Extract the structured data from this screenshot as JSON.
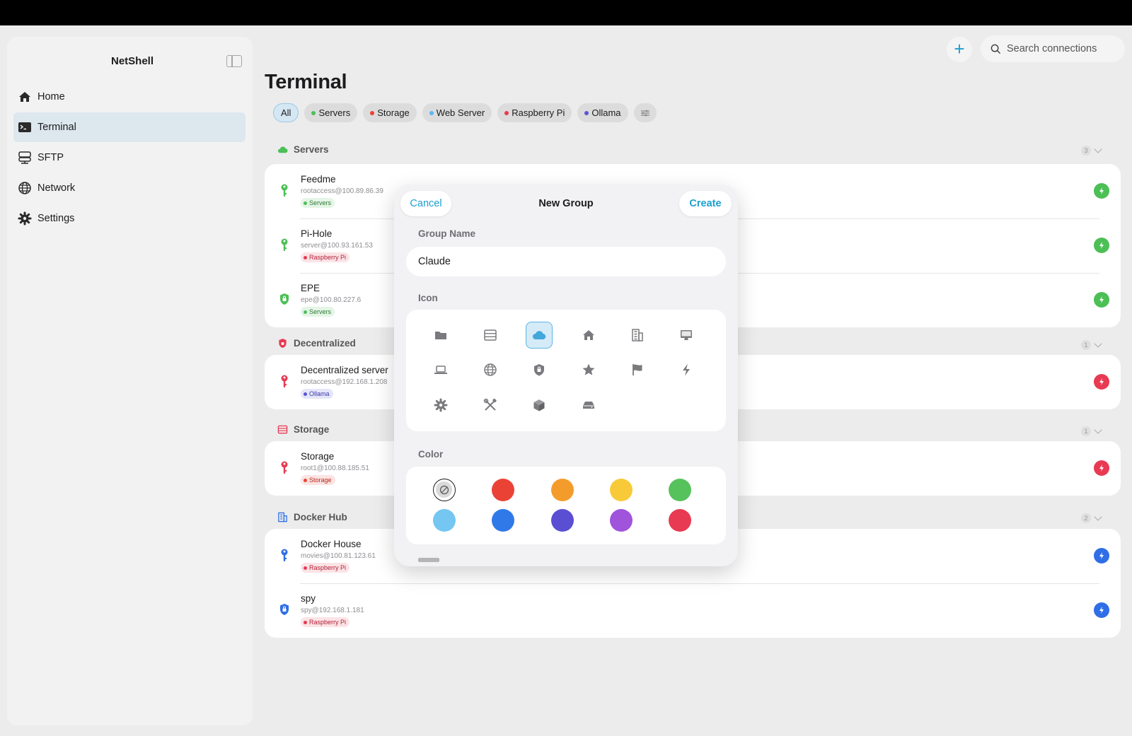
{
  "app": {
    "title": "NetShell"
  },
  "sidebar": {
    "items": [
      {
        "label": "Home",
        "icon": "house-icon"
      },
      {
        "label": "Terminal",
        "icon": "terminal-icon",
        "active": true
      },
      {
        "label": "SFTP",
        "icon": "server-stack-icon"
      },
      {
        "label": "Network",
        "icon": "globe-icon"
      },
      {
        "label": "Settings",
        "icon": "gear-icon"
      }
    ]
  },
  "header": {
    "add_label": "+",
    "search_placeholder": "Search connections"
  },
  "page": {
    "title": "Terminal"
  },
  "filters": [
    {
      "label": "All",
      "active": true
    },
    {
      "label": "Servers",
      "color": "#4cbf56"
    },
    {
      "label": "Storage",
      "color": "#ea4335"
    },
    {
      "label": "Web Server",
      "color": "#5ab8ef"
    },
    {
      "label": "Raspberry Pi",
      "color": "#e83a52"
    },
    {
      "label": "Ollama",
      "color": "#5856d6"
    }
  ],
  "sections": [
    {
      "title": "Servers",
      "count": "3",
      "color": "#4cbf56",
      "rows": [
        {
          "name": "Feedme",
          "address": "rootaccess@100.89.86.39",
          "tag": "Servers",
          "tag_color": "#4cbf56",
          "tag_bg": "#e4f5e6",
          "icon": "key-icon"
        },
        {
          "name": "Pi-Hole",
          "address": "server@100.93.161.53",
          "tag": "Raspberry Pi",
          "tag_color": "#e83a52",
          "tag_bg": "#fbe3e6",
          "icon": "key-icon"
        },
        {
          "name": "EPE",
          "address": "epe@100.80.227.6",
          "tag": "Servers",
          "tag_color": "#4cbf56",
          "tag_bg": "#e4f5e6",
          "icon": "lock-icon"
        }
      ]
    },
    {
      "title": "Decentralized",
      "count": "1",
      "color": "#e83a52",
      "rows": [
        {
          "name": "Decentralized server",
          "address": "rootaccess@192.168.1.208",
          "tag": "Ollama",
          "tag_color": "#5856d6",
          "tag_bg": "#e6e6fa",
          "icon": "key-icon"
        }
      ]
    },
    {
      "title": "Storage",
      "count": "1",
      "color": "#e83a52",
      "rows": [
        {
          "name": "Storage",
          "address": "root1@100.88.185.51",
          "tag": "Storage",
          "tag_color": "#ea4335",
          "tag_bg": "#fbe4e2",
          "icon": "key-icon"
        }
      ]
    },
    {
      "title": "Docker Hub",
      "count": "2",
      "color": "#2f6ee6",
      "rows": [
        {
          "name": "Docker House",
          "address": "movies@100.81.123.61",
          "tag": "Raspberry Pi",
          "tag_color": "#e83a52",
          "tag_bg": "#fbe3e6",
          "icon": "key-icon"
        },
        {
          "name": "spy",
          "address": "spy@192.168.1.181",
          "tag": "Raspberry Pi",
          "tag_color": "#e83a52",
          "tag_bg": "#fbe3e6",
          "icon": "lock-icon"
        }
      ]
    }
  ],
  "modal": {
    "cancel_label": "Cancel",
    "title": "New Group",
    "create_label": "Create",
    "group_name_label": "Group Name",
    "group_name_value": "Claude",
    "icon_label": "Icon",
    "color_label": "Color",
    "icons": [
      "folder-icon",
      "server-icon",
      "cloud-icon",
      "house-icon",
      "building-icon",
      "desktop-icon",
      "laptop-icon",
      "globe-icon",
      "shield-icon",
      "star-icon",
      "flag-icon",
      "bolt-icon",
      "gear-icon",
      "tools-icon",
      "cube-icon",
      "drive-icon"
    ],
    "selected_icon": "cloud-icon",
    "colors": [
      "none",
      "#ea4335",
      "#f39c2b",
      "#f8ca3a",
      "#56c25b",
      "#76c6f2",
      "#2f7ae8",
      "#5a4fd2",
      "#a053db",
      "#e83a52"
    ],
    "selected_color": "none"
  }
}
